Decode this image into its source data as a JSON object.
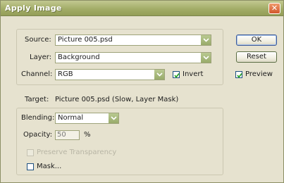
{
  "window": {
    "title": "Apply Image",
    "close_glyph": "✕"
  },
  "source": {
    "label": "Source:",
    "value": "Picture 005.psd"
  },
  "layer": {
    "label": "Layer:",
    "value": "Background"
  },
  "channel": {
    "label": "Channel:",
    "value": "RGB"
  },
  "invert": {
    "label": "Invert",
    "checked": true
  },
  "target": {
    "label": "Target:",
    "value": "Picture 005.psd (Slow, Layer Mask)"
  },
  "blending": {
    "label": "Blending:",
    "value": "Normal"
  },
  "opacity": {
    "label": "Opacity:",
    "value": "50",
    "unit": "%"
  },
  "preserve_transparency": {
    "label": "Preserve Transparency",
    "checked": false,
    "enabled": false
  },
  "mask": {
    "label": "Mask...",
    "checked": false
  },
  "buttons": {
    "ok": "OK",
    "reset": "Reset"
  },
  "preview": {
    "label": "Preview",
    "checked": true
  },
  "colors": {
    "titlebar": "#a3ad68",
    "dialog_bg": "#e6e2cf",
    "close_button": "#d2562b",
    "checkbox_border": "#1d5080",
    "dropdown_arrow": "#98ab6a"
  },
  "icons": {
    "dropdown": "chevron-down-icon",
    "check": "check-icon",
    "close": "close-icon"
  }
}
